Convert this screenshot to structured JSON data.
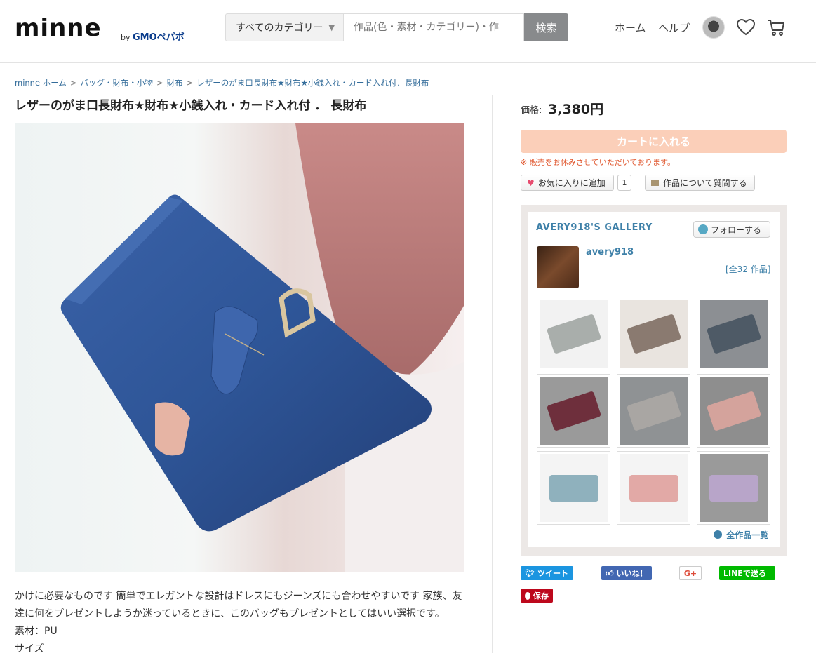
{
  "header": {
    "logo": "minne",
    "logo_by": "by",
    "logo_company": "GMOペパボ",
    "category_select": "すべてのカテゴリー",
    "search_placeholder": "作品(色・素材・カテゴリー)・作",
    "search_button": "検索",
    "nav_home": "ホーム",
    "nav_help": "ヘルプ"
  },
  "breadcrumb": [
    "minne ホーム",
    "バッグ・財布・小物",
    "財布",
    "レザーのがま口長財布★財布★小銭入れ・カード入れ付．長財布"
  ],
  "product": {
    "title": "レザーのがま口長財布★財布★小銭入れ・カード入れ付 ． 長財布",
    "description_1": "かけに必要なものです 簡単でエレガントな設計はドレスにもジーンズにも合わせやすいです 家族、友",
    "description_2": "達に何をプレゼントしようか迷っているときに、このバッグもプレゼントとしてはいい選択です。",
    "material": "素材：PU",
    "size": "サイズ"
  },
  "purchase": {
    "price_label": "価格:",
    "price": "3,380円",
    "cart_button": "カートに入れる",
    "notice": "※ 販売をお休みさせていただいております。",
    "favorite_button": "お気に入りに追加",
    "favorite_count": "1",
    "question_button": "作品について質問する"
  },
  "gallery": {
    "title": "AVERY918'S  GALLERY",
    "follow_button": "フォローする",
    "shop_name": "avery918",
    "item_count": "[全32 作品]",
    "all_items_link": "全作品一覧",
    "thumbs": [
      {
        "color": "#a9aeab",
        "bg": "#f2f2f2"
      },
      {
        "color": "#8a7a70",
        "bg": "#e9e4df"
      },
      {
        "color": "#4e5a66",
        "bg": "#8c8f93"
      },
      {
        "color": "#6e2f3c",
        "bg": "#9a9a9a"
      },
      {
        "color": "#a9a6a3",
        "bg": "#8f9294"
      },
      {
        "color": "#d4a39c",
        "bg": "#8e8e8e"
      },
      {
        "color": "#8fb1bd",
        "bg": "#f4f4f4"
      },
      {
        "color": "#e2a9a6",
        "bg": "#f4f4f4"
      },
      {
        "color": "#b8a5c9",
        "bg": "#9a9a9a"
      }
    ]
  },
  "share": {
    "tweet": "ツイート",
    "like": "いいね！",
    "gplus": "G+",
    "line": "LINEで送る",
    "pin": "保存"
  },
  "colors": {
    "link": "#3e80a8",
    "cart": "#fbcfb9",
    "notice": "#e0562d",
    "twitter": "#1b95e0",
    "facebook": "#4267b2",
    "line": "#00b900",
    "pinterest": "#bd081c"
  }
}
